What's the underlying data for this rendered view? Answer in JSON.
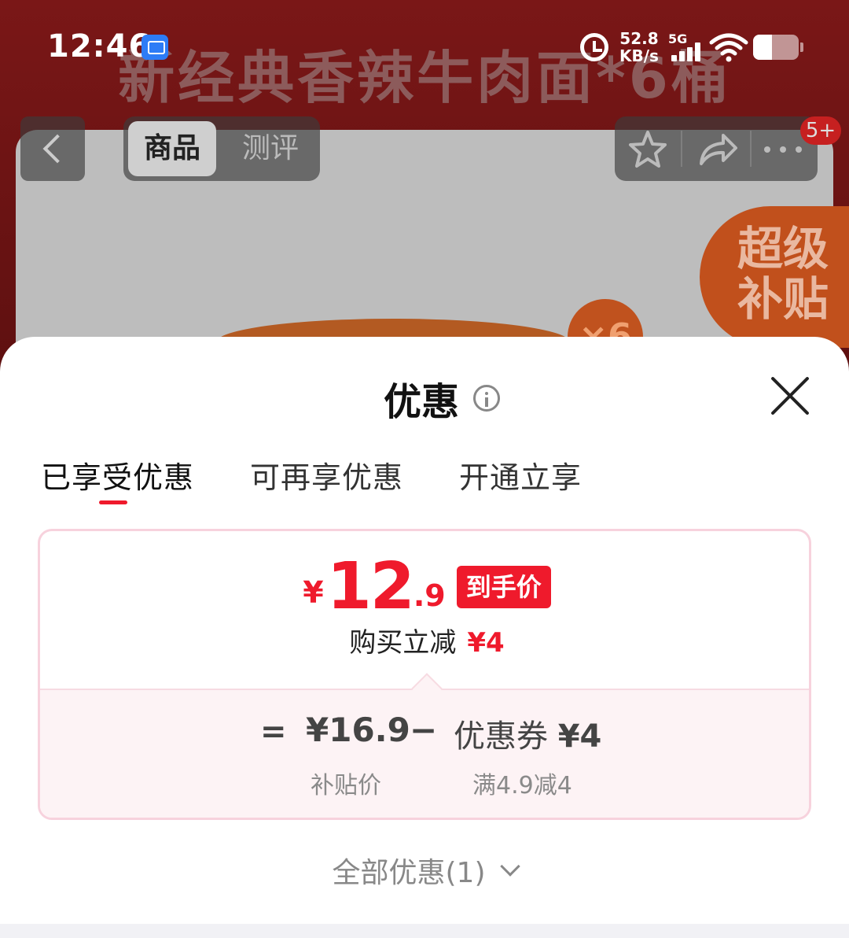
{
  "background": {
    "banner_text": "新经典香辣牛肉面*6桶",
    "x6_badge": "×6",
    "subsidy_badge": "超级补贴"
  },
  "status_bar": {
    "time": "12:46",
    "speed_value": "52.8",
    "speed_unit": "KB/s",
    "network": "5G"
  },
  "nav": {
    "tabs": [
      {
        "label": "商品",
        "active": true
      },
      {
        "label": "测评",
        "active": false
      }
    ],
    "message_badge": "5+"
  },
  "sheet": {
    "title": "优惠",
    "tabs": [
      {
        "label": "已享受优惠",
        "active": true
      },
      {
        "label": "可再享优惠",
        "active": false
      },
      {
        "label": "开通立享",
        "active": false
      }
    ],
    "price": {
      "currency": "¥",
      "integer": "12",
      "decimal": ".9",
      "tag": "到手价",
      "reduce_label": "购买立减",
      "reduce_value": "¥4"
    },
    "calc": {
      "equals": "=",
      "base_value": "¥16.9",
      "minus": "−",
      "coupon_label": "优惠券",
      "coupon_value": "¥4",
      "base_caption": "补贴价",
      "coupon_caption": "满4.9减4"
    },
    "all_offers": "全部优惠(1)"
  },
  "colors": {
    "accent_red": "#ef1a2c",
    "card_border": "#f7d2dd",
    "card_tint": "#fdf3f5"
  }
}
